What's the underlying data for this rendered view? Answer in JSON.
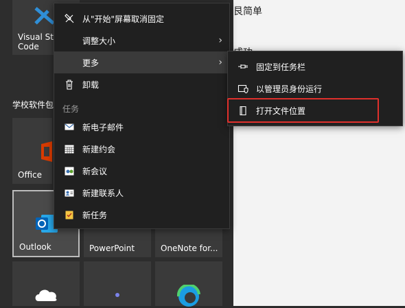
{
  "background": {
    "text_top": "艮简单",
    "text_mid": "成功"
  },
  "tiles": {
    "vscode": "Visual Studio Code",
    "office": "Office",
    "outlook": "Outlook",
    "powerpoint": "PowerPoint",
    "onenote": "OneNote for..."
  },
  "group": {
    "label": "学校软件包"
  },
  "context_menu": {
    "items": [
      {
        "label": "从\"开始\"屏幕取消固定",
        "icon": "unpin-icon"
      },
      {
        "label": "调整大小",
        "icon": "none",
        "has_submenu": true
      },
      {
        "label": "更多",
        "icon": "none",
        "has_submenu": true,
        "active": true
      },
      {
        "label": "卸载",
        "icon": "trash-icon"
      }
    ],
    "section_label": "任务",
    "tasks": [
      {
        "label": "新电子邮件",
        "icon": "mail-icon"
      },
      {
        "label": "新建约会",
        "icon": "calendar-icon"
      },
      {
        "label": "新会议",
        "icon": "meeting-icon"
      },
      {
        "label": "新建联系人",
        "icon": "contact-icon"
      },
      {
        "label": "新任务",
        "icon": "task-icon"
      }
    ]
  },
  "submenu": {
    "items": [
      {
        "label": "固定到任务栏",
        "icon": "pin-icon"
      },
      {
        "label": "以管理员身份运行",
        "icon": "shield-icon"
      },
      {
        "label": "打开文件位置",
        "icon": "folder-icon",
        "highlighted": true
      }
    ]
  },
  "colors": {
    "highlight_border": "#e0302c",
    "menu_bg": "#202020",
    "active_item": "#3a3a3a"
  }
}
